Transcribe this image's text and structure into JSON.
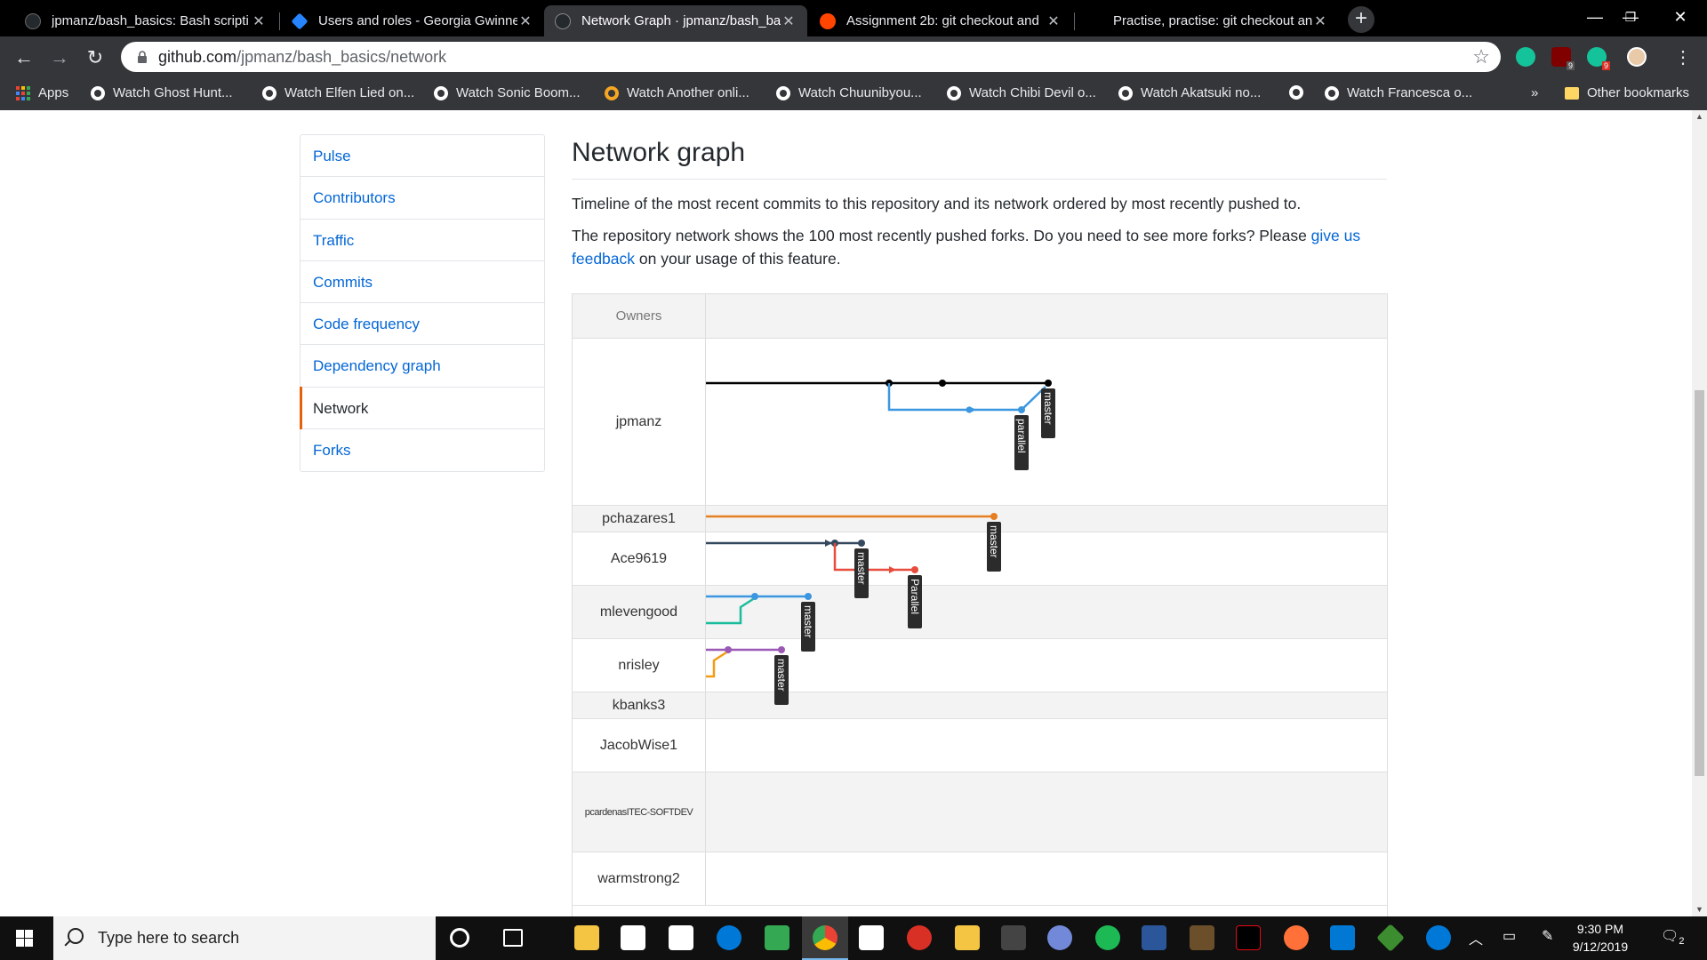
{
  "browser": {
    "tabs": [
      {
        "title": "jpmanz/bash_basics: Bash scripti",
        "icon": "github-icon"
      },
      {
        "title": "Users and roles - Georgia Gwinne",
        "icon": "jira-icon"
      },
      {
        "title": "Network Graph · jpmanz/bash_ba",
        "icon": "github-icon",
        "active": true
      },
      {
        "title": "Assignment 2b: git checkout and",
        "icon": "reddit-icon"
      },
      {
        "title": "Practise, practise: git checkout an",
        "icon": "blank-icon"
      }
    ],
    "url_host": "github.com",
    "url_path": "/jpmanz/bash_basics/network",
    "extension_badges": [
      "9",
      "9"
    ],
    "bookmarks": [
      "Apps",
      "Watch Ghost Hunt...",
      "Watch Elfen Lied on...",
      "Watch Sonic Boom...",
      "Watch Another onli...",
      "Watch Chuunibyou...",
      "Watch Chibi Devil o...",
      "Watch Akatsuki no...",
      "",
      "Watch Francesca o..."
    ],
    "bookmarks_overflow": "»",
    "other_bookmarks": "Other bookmarks"
  },
  "sidebar": {
    "items": [
      {
        "label": "Pulse"
      },
      {
        "label": "Contributors"
      },
      {
        "label": "Traffic"
      },
      {
        "label": "Commits"
      },
      {
        "label": "Code frequency"
      },
      {
        "label": "Dependency graph"
      },
      {
        "label": "Network",
        "selected": true
      },
      {
        "label": "Forks"
      }
    ]
  },
  "main": {
    "title": "Network graph",
    "desc1": "Timeline of the most recent commits to this repository and its network ordered by most recently pushed to.",
    "desc2_pre": "The repository network shows the 100 most recently pushed forks. Do you need to see more forks? Please ",
    "desc2_link": "give us feedback",
    "desc2_post": " on your usage of this feature."
  },
  "graph": {
    "owners_header": "Owners",
    "rows": [
      {
        "owner": "jpmanz"
      },
      {
        "owner": "pchazares1"
      },
      {
        "owner": "Ace9619"
      },
      {
        "owner": "mlevengood"
      },
      {
        "owner": "nrisley"
      },
      {
        "owner": "kbanks3"
      },
      {
        "owner": "JacobWise1"
      },
      {
        "owner": "pcardenasITEC-SOFTDEV"
      },
      {
        "owner": "warmstrong2"
      }
    ],
    "branch_labels": [
      "master",
      "parallel",
      "master",
      "master",
      "Parallel",
      "master",
      "master"
    ],
    "colors": {
      "jpmanz": "#000000",
      "parallel": "#3b97e0",
      "pchazares1": "#e67e22",
      "ace9619": "#34495e",
      "ace_parallel": "#e74c3c",
      "mlevengood": "#3b97e0",
      "mlevengood_alt": "#1abc9c",
      "nrisley": "#9b59b6",
      "nrisley_alt": "#f39c12"
    }
  },
  "taskbar": {
    "search_placeholder": "Type here to search",
    "time": "9:30 PM",
    "date": "9/12/2019",
    "notification_count": "2"
  }
}
